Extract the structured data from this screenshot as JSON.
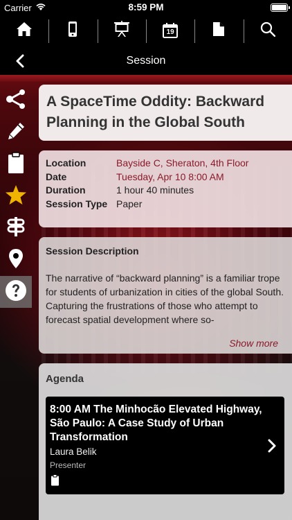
{
  "status": {
    "carrier": "Carrier",
    "time": "8:59 PM"
  },
  "toolbar": {
    "items": [
      {
        "icon": "home-icon"
      },
      {
        "icon": "phone-icon"
      },
      {
        "icon": "presentation-icon"
      },
      {
        "icon": "calendar-icon",
        "day": "19"
      },
      {
        "icon": "document-icon"
      },
      {
        "icon": "search-icon"
      }
    ]
  },
  "nav": {
    "title": "Session"
  },
  "sidebar": {
    "items": [
      {
        "icon": "share-icon"
      },
      {
        "icon": "pencil-icon"
      },
      {
        "icon": "clipboard-icon"
      },
      {
        "icon": "star-icon",
        "color": "#f0b400"
      },
      {
        "icon": "signpost-icon"
      },
      {
        "icon": "location-pin-icon"
      },
      {
        "icon": "help-icon",
        "active": true
      }
    ]
  },
  "session": {
    "title": "A SpaceTime Oddity: Backward Planning in the Global South",
    "location_label": "Location",
    "location": "Bayside C, Sheraton, 4th Floor",
    "date_label": "Date",
    "date": "Tuesday, Apr 10 8:00 AM",
    "duration_label": "Duration",
    "duration": "1 hour 40 minutes",
    "type_label": "Session Type",
    "type": "Paper"
  },
  "description": {
    "heading": "Session Description",
    "text": "The narrative of “backward planning” is a familiar trope for students of urbanization in cities of the global South. Capturing the frustrations of those who attempt to forecast spatial development where so-",
    "show_more": "Show more"
  },
  "agenda": {
    "heading": "Agenda",
    "items": [
      {
        "title": "8:00 AM  The Minhocão Elevated Highway, São Paulo: A Case Study of Urban Transformation",
        "presenter": "Laura Belik",
        "role": "Presenter"
      }
    ]
  },
  "colors": {
    "accent": "#8a1a2a",
    "star": "#f0b400"
  }
}
